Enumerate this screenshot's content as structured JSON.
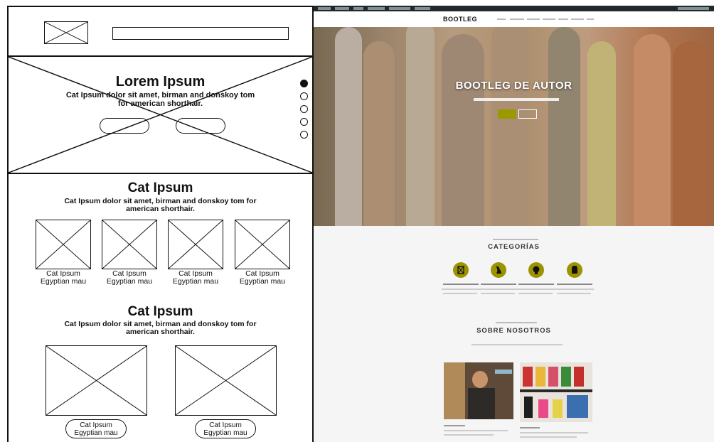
{
  "wireframe": {
    "hero": {
      "title": "Lorem Ipsum",
      "subtitle": "Cat Ipsum dolor sit amet, birman and donskoy tom for american shorthair."
    },
    "section1": {
      "title": "Cat Ipsum",
      "subtitle": "Cat Ipsum dolor sit amet, birman and donskoy tom for american shorthair.",
      "items": [
        {
          "line1": "Cat Ipsum",
          "line2": "Egyptian mau"
        },
        {
          "line1": "Cat Ipsum",
          "line2": "Egyptian mau"
        },
        {
          "line1": "Cat Ipsum",
          "line2": "Egyptian mau"
        },
        {
          "line1": "Cat Ipsum",
          "line2": "Egyptian mau"
        }
      ]
    },
    "section2": {
      "title": "Cat Ipsum",
      "subtitle": "Cat Ipsum dolor sit amet, birman and donskoy tom for american shorthair.",
      "items": [
        {
          "line1": "Cat Ipsum",
          "line2": "Egyptian mau"
        },
        {
          "line1": "Cat Ipsum",
          "line2": "Egyptian mau"
        }
      ]
    }
  },
  "site": {
    "logo": "BOOTLEG",
    "hero_title": "BOOTLEG DE AUTOR",
    "categories_title": "CATEGORÍAS",
    "about_title": "SOBRE NOSOTROS",
    "accent_color": "#9b9400"
  }
}
